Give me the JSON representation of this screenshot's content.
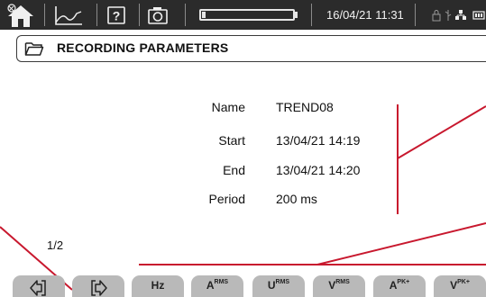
{
  "statusbar": {
    "datetime": "16/04/21 11:31",
    "battery_level": 0.04,
    "icons": [
      "home-icon",
      "trend-icon",
      "help-icon",
      "camera-icon",
      "usb-icon",
      "network-icon",
      "memory-icon"
    ]
  },
  "header": {
    "title": "RECORDING PARAMETERS",
    "icon": "folder-icon"
  },
  "parameters": [
    {
      "label": "Name",
      "value": "TREND08"
    },
    {
      "label": "Start",
      "value": "13/04/21 14:19"
    },
    {
      "label": "End",
      "value": "13/04/21 14:20"
    },
    {
      "label": "Period",
      "value": "200 ms"
    }
  ],
  "page": "1/2",
  "function_keys": [
    {
      "icon": "page-back-icon",
      "label": ""
    },
    {
      "icon": "page-forward-icon",
      "label": ""
    },
    {
      "main": "Hz",
      "sub": ""
    },
    {
      "main": "A",
      "sub": "RMS"
    },
    {
      "main": "U",
      "sub": "RMS"
    },
    {
      "main": "V",
      "sub": "RMS"
    },
    {
      "main": "A",
      "sub": "PK+"
    },
    {
      "main": "V",
      "sub": "PK+"
    }
  ],
  "colors": {
    "topbar": "#2b2b2b",
    "key": "#b9b9b9",
    "annotation": "#c8182e"
  }
}
